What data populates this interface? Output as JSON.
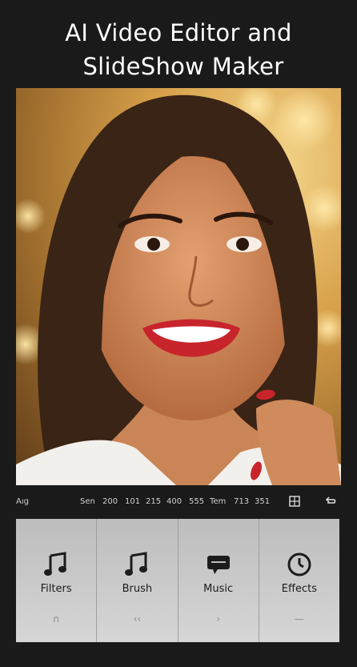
{
  "app": {
    "title_line1": "AI Video Editor and",
    "title_line2": "SlideShow Maker"
  },
  "timeline": {
    "left_label": "Aıg",
    "values": [
      "Sen",
      "200",
      "101",
      "215",
      "400",
      "555",
      "Tem",
      "713",
      "351"
    ],
    "icon_right_1": "grid-icon",
    "icon_right_2": "undo-icon"
  },
  "tools": [
    {
      "label": "Filters",
      "icon": "music-note-icon",
      "sub": "∩"
    },
    {
      "label": "Brush",
      "icon": "music-note-icon",
      "sub": "‹‹"
    },
    {
      "label": "Music",
      "icon": "chat-icon",
      "sub": "›"
    },
    {
      "label": "Effects",
      "icon": "clock-icon",
      "sub": "—"
    }
  ],
  "colors": {
    "background": "#1a1a1a",
    "toolbar": "#c4c4c4",
    "lipstick": "#c8242c"
  }
}
